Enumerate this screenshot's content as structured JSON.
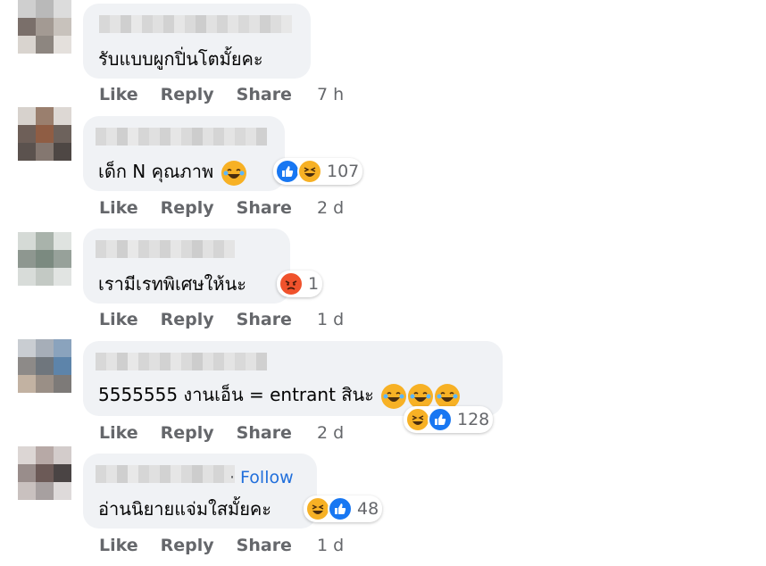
{
  "actions": {
    "like": "Like",
    "reply": "Reply",
    "share": "Share"
  },
  "comments": [
    {
      "text": "รับแบบผูกปิ่นโตมั้ยคะ",
      "time": "7 h",
      "reaction_count": ""
    },
    {
      "text": "เด็ก N คุณภาพ",
      "time": "2 d",
      "reaction_count": "107"
    },
    {
      "text": "เรามีเรทพิเศษให้นะ",
      "time": "1 d",
      "reaction_count": "1"
    },
    {
      "text": "5555555 งานเอ็น = entrant สินะ",
      "time": "2 d",
      "reaction_count": "128"
    },
    {
      "text": "อ่านนิยายแจ่มใสมั้ยคะ",
      "time": "1 d",
      "reaction_count": "48",
      "follow": "Follow",
      "follow_sep": "·"
    }
  ],
  "colors": {
    "like": "#1877f2",
    "haha": "#f7b125",
    "angry": "#f0522c",
    "bubble": "#f0f2f5",
    "meta": "#65676b",
    "follow": "#216fdb"
  }
}
